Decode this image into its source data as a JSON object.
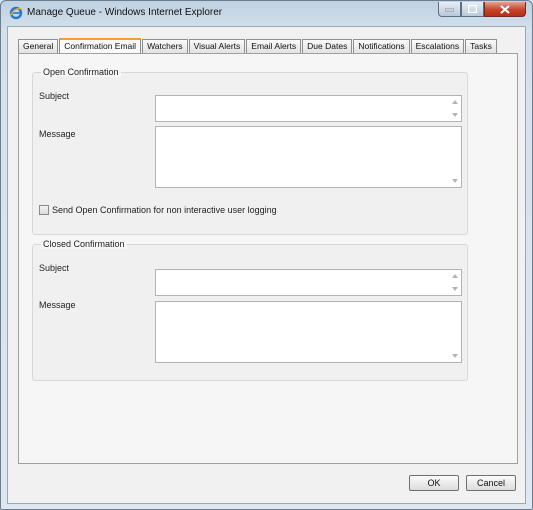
{
  "window": {
    "title": "Manage Queue - Windows Internet Explorer"
  },
  "tabs": [
    {
      "label": "General"
    },
    {
      "label": "Confirmation Email",
      "active": true
    },
    {
      "label": "Watchers"
    },
    {
      "label": "Visual Alerts"
    },
    {
      "label": "Email Alerts"
    },
    {
      "label": "Due Dates"
    },
    {
      "label": "Notifications"
    },
    {
      "label": "Escalations"
    },
    {
      "label": "Tasks"
    }
  ],
  "open_confirmation": {
    "title": "Open Confirmation",
    "subject_label": "Subject",
    "subject_value": "",
    "message_label": "Message",
    "message_value": "",
    "checkbox_label": "Send Open Confirmation for non interactive user logging",
    "checkbox_checked": false
  },
  "closed_confirmation": {
    "title": "Closed Confirmation",
    "subject_label": "Subject",
    "subject_value": "",
    "message_label": "Message",
    "message_value": ""
  },
  "footer": {
    "ok_label": "OK",
    "cancel_label": "Cancel"
  },
  "colors": {
    "active_tab_accent": "#f0a030",
    "close_button": "#c8432a"
  },
  "icons": {
    "app": "internet-explorer-icon",
    "minimize": "minimize-icon",
    "maximize": "maximize-icon",
    "close": "close-icon"
  }
}
